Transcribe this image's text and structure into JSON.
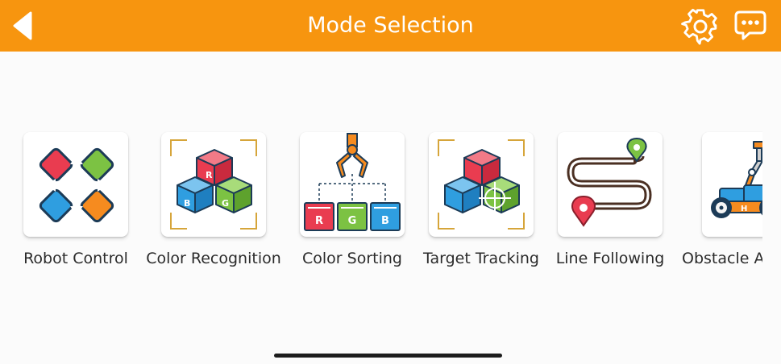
{
  "header": {
    "title": "Mode Selection",
    "background": "#f7950f",
    "back_icon": "back-arrow-icon",
    "settings_icon": "gear-icon",
    "chat_icon": "chat-bubble-icon"
  },
  "modes": [
    {
      "label": "Robot Control",
      "icon": "dpad-icon"
    },
    {
      "label": "Color Recognition",
      "icon": "color-cubes-icon"
    },
    {
      "label": "Color Sorting",
      "icon": "claw-sorting-icon"
    },
    {
      "label": "Target Tracking",
      "icon": "target-cubes-icon"
    },
    {
      "label": "Line Following",
      "icon": "path-route-icon"
    },
    {
      "label": "Obstacle A",
      "icon": "robot-car-icon"
    }
  ],
  "cube_letters": {
    "red": "R",
    "blue": "B",
    "green": "G"
  },
  "sorting_letters": [
    "R",
    "G",
    "B"
  ],
  "robot_letter": "H",
  "colors": {
    "red": "#e93c50",
    "green": "#7cc243",
    "blue": "#2f9ee0",
    "orange": "#f68b1f",
    "bracket": "#d6a53a"
  }
}
